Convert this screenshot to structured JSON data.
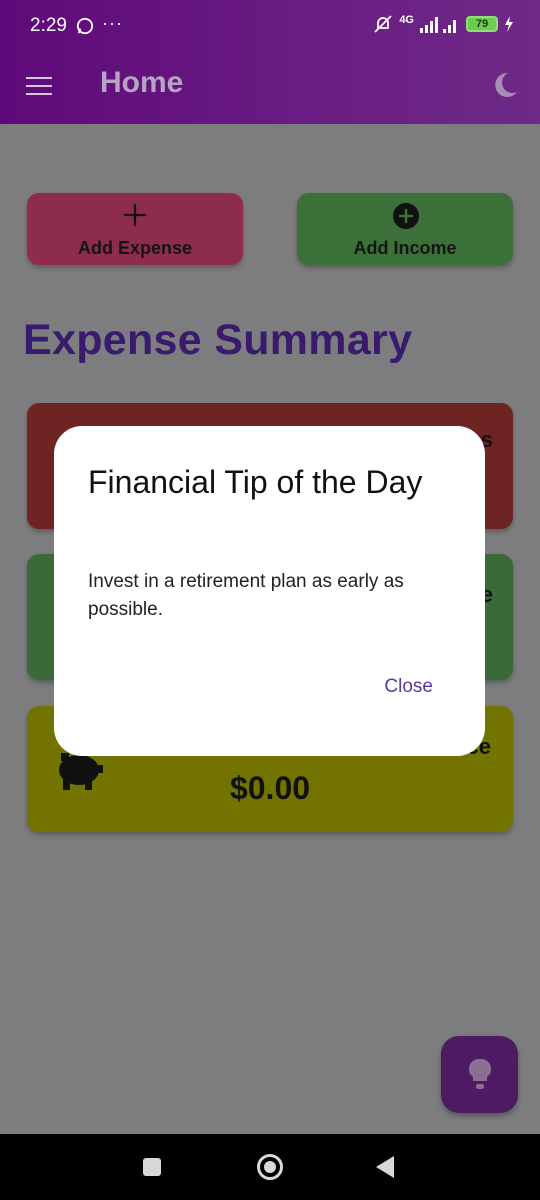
{
  "status_bar": {
    "time": "2:29",
    "more": "···",
    "network": "4G",
    "battery": "79"
  },
  "app_bar": {
    "title": "Home"
  },
  "actions": {
    "add_expense_label": "Add Expense",
    "add_income_label": "Add Income"
  },
  "summary": {
    "title": "Expense Summary",
    "balance_amount": "$0.00",
    "expense_peek": "s",
    "income_peek": "e",
    "balance_peek": "ce"
  },
  "dialog": {
    "title": "Financial Tip of the Day",
    "body": "Invest in a retirement plan as early as possible.",
    "close_label": "Close"
  },
  "colors": {
    "app_bar": "#6a1c82",
    "expense": "#8d2c4b",
    "income": "#3b7038",
    "balance": "#737300",
    "accent": "#5a3a9a"
  },
  "icons": [
    "whatsapp-icon",
    "mute-icon",
    "signal-icon",
    "battery-icon",
    "menu-icon",
    "moon-icon",
    "plus-icon",
    "plus-circle-icon",
    "piggy-bank-icon",
    "lightbulb-icon"
  ]
}
